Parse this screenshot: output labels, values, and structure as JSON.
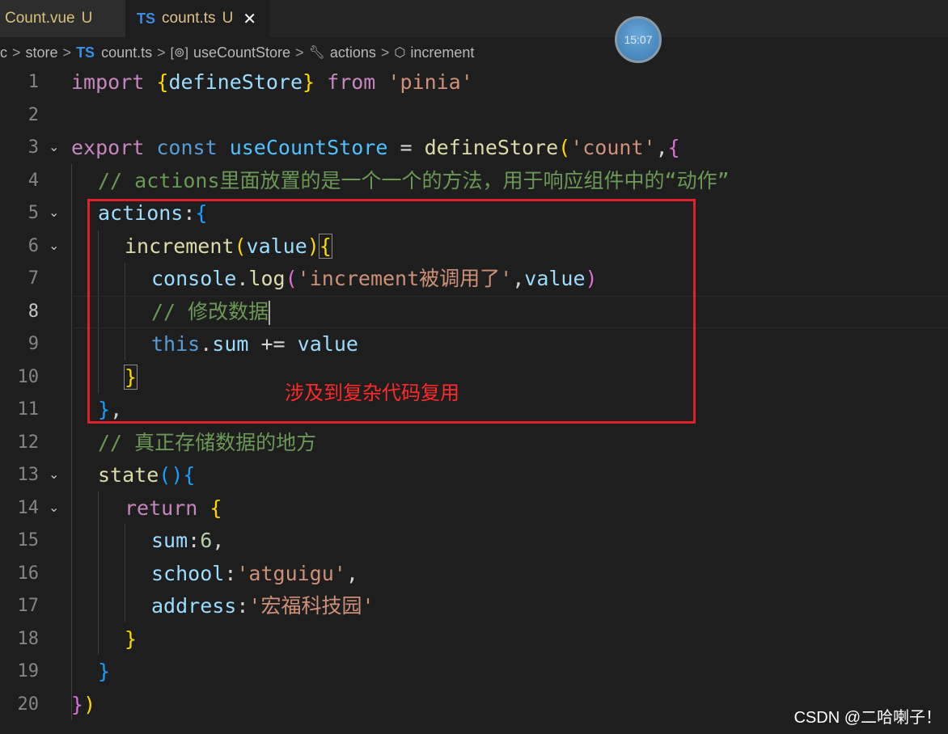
{
  "tabs": [
    {
      "name": "Count.vue",
      "status": "U",
      "active": false
    },
    {
      "badge": "TS",
      "name": "count.ts",
      "status": "U",
      "active": true,
      "close": "✕"
    }
  ],
  "clock": "15:07",
  "breadcrumb": {
    "items": [
      "c",
      "store",
      "count.ts",
      "useCountStore",
      "actions",
      "increment"
    ],
    "ts_badge": "TS",
    "separator": ">"
  },
  "editor": {
    "lines": [
      {
        "n": "1"
      },
      {
        "n": "2"
      },
      {
        "n": "3"
      },
      {
        "n": "4"
      },
      {
        "n": "5"
      },
      {
        "n": "6"
      },
      {
        "n": "7"
      },
      {
        "n": "8"
      },
      {
        "n": "9"
      },
      {
        "n": "10"
      },
      {
        "n": "11"
      },
      {
        "n": "12"
      },
      {
        "n": "13"
      },
      {
        "n": "14"
      },
      {
        "n": "15"
      },
      {
        "n": "16"
      },
      {
        "n": "17"
      },
      {
        "n": "18"
      },
      {
        "n": "19"
      },
      {
        "n": "20"
      }
    ],
    "active_line": "8",
    "tokens": {
      "l1": [
        "import",
        "{",
        "defineStore",
        "}",
        "from",
        "'pinia'"
      ],
      "l3": [
        "export",
        "const",
        "useCountStore",
        "=",
        "defineStore",
        "(",
        "'count'",
        ",",
        "{"
      ],
      "l4": "// actions里面放置的是一个一个的方法，用于响应组件中的“动作”",
      "l5": [
        "actions",
        ":",
        "{"
      ],
      "l6": [
        "increment",
        "(",
        "value",
        ")",
        "{"
      ],
      "l7": [
        "console",
        ".",
        "log",
        "(",
        "'increment被调用了'",
        ",",
        "value",
        ")"
      ],
      "l8": "// 修改数据",
      "l9": [
        "this",
        ".",
        "sum",
        "+=",
        "value"
      ],
      "l10": "}",
      "l11": [
        "}",
        ","
      ],
      "l12": "// 真正存储数据的地方",
      "l13": [
        "state",
        "(",
        ")",
        "{"
      ],
      "l14": [
        "return",
        "{"
      ],
      "l15": [
        "sum",
        ":",
        "6",
        ","
      ],
      "l16": [
        "school",
        ":",
        "'atguigu'",
        ","
      ],
      "l17": [
        "address",
        ":",
        "'宏福科技园'"
      ],
      "l18": "}",
      "l19": "}",
      "l20": [
        "}",
        ")"
      ]
    }
  },
  "annotation": "涉及到复杂代码复用",
  "watermark": "CSDN @二哈喇子！",
  "colors": {
    "highlight_box": "#e0202a",
    "annotation": "#ff2a2a"
  }
}
